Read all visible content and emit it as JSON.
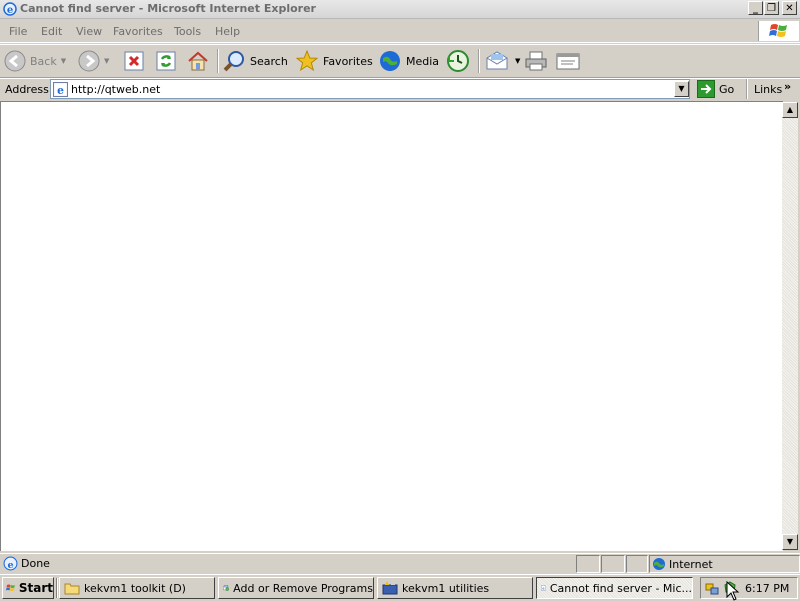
{
  "window": {
    "title": "Cannot find server - Microsoft Internet Explorer",
    "controls": {
      "minimize": "_",
      "maximize": "❐",
      "close": "✕"
    }
  },
  "menu": {
    "items": [
      "File",
      "Edit",
      "View",
      "Favorites",
      "Tools",
      "Help"
    ]
  },
  "toolbar": {
    "back_label": "Back",
    "search_label": "Search",
    "favorites_label": "Favorites",
    "media_label": "Media"
  },
  "address": {
    "label": "Address",
    "value": "http://qtweb.net",
    "go_label": "Go",
    "links_label": "Links",
    "more": "»"
  },
  "status": {
    "text": "Done",
    "zone": "Internet"
  },
  "taskbar": {
    "start_label": "Start",
    "tasks": [
      {
        "label": "kekvm1 toolkit (D)",
        "icon": "folder-icon"
      },
      {
        "label": "Add or Remove Programs",
        "icon": "programs-icon"
      },
      {
        "label": "kekvm1 utilities",
        "icon": "utilities-icon"
      },
      {
        "label": "Cannot find server - Mic...",
        "icon": "ie-icon"
      }
    ],
    "clock": "6:17 PM"
  },
  "colors": {
    "ie_blue": "#1e6bd6",
    "back_green": "#2f9e2f",
    "stop_red": "#d22a2a",
    "favorites_yellow": "#f0c020",
    "go_green": "#2d9a2d"
  }
}
